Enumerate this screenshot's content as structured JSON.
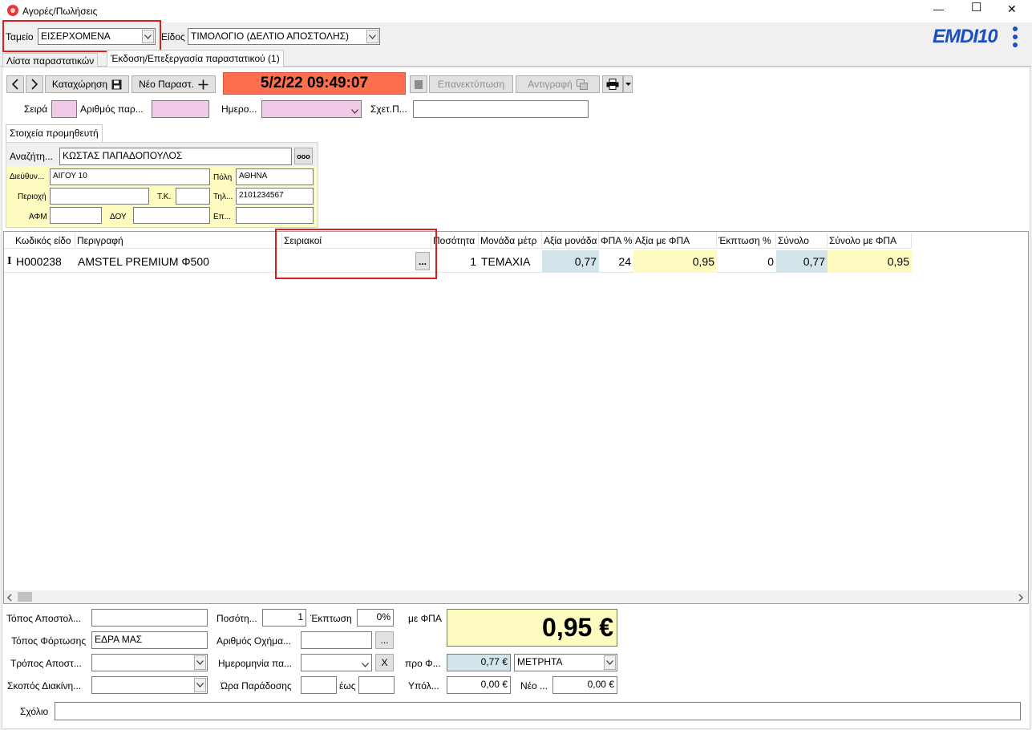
{
  "window": {
    "title": "Αγορές/Πωλήσεις",
    "minimize": "—",
    "maximize": "☐",
    "close": "✕",
    "logo": "EMDI10"
  },
  "top": {
    "tameio_label": "Ταμείο",
    "tameio_value": "ΕΙΣΕΡΧΟΜΕΝΑ",
    "eidos_label": "Είδος",
    "eidos_value": "ΤΙΜΟΛΟΓΙΟ (ΔΕΛΤΙΟ ΑΠΟΣΤΟΛΗΣ)"
  },
  "tabs": [
    "Λίστα παραστατικών",
    "Έκδοση/Επεξεργασία παραστατικού (1)"
  ],
  "toolbar": {
    "prev": "<",
    "next": ">",
    "save_label": "Καταχώρηση",
    "new_label": "Νέο Παραστ.",
    "datetime": "5/2/22 09:49:07",
    "reprint_label": "Επανεκτύπωση",
    "copy_label": "Αντιγραφή"
  },
  "doc": {
    "seira_label": "Σειρά",
    "seira_value": "",
    "arithmos_label": "Αριθμός παρ...",
    "arithmos_value": "",
    "date_label": "Ημερο...",
    "date_value": "",
    "sxet_label": "Σχετ.Π...",
    "sxet_value": ""
  },
  "supplier": {
    "tab": "Στοιχεία προμηθευτή",
    "search_label": "Αναζήτη...",
    "search_value": "ΚΩΣΤΑΣ ΠΑΠΑΔΟΠΟΥΛΟΣ",
    "more": "ooo",
    "address_label": "Διεύθυν...",
    "address_value": "ΑΙΓΟΥ 10",
    "city_label": "Πόλη",
    "city_value": "ΑΘΗΝΑ",
    "area_label": "Περιοχή",
    "area_value": "",
    "tk_label": "Τ.Κ.",
    "tk_value": "",
    "phone_label": "Τηλ...",
    "phone_value": "2101234567",
    "afm_label": "ΑΦΜ",
    "afm_value": "",
    "doy_label": "ΔΟΥ",
    "doy_value": "",
    "ep_label": "Επ...",
    "ep_value": ""
  },
  "grid": {
    "headers": [
      "Κωδικός είδο",
      "Περιγραφή",
      "Σειριακοί",
      "Ποσότητα",
      "Μονάδα μέτρ",
      "Αξία μονάδα",
      "ΦΠΑ %",
      "Αξία με ΦΠΑ",
      "Έκπτωση %",
      "Σύνολο",
      "Σύνολο με ΦΠΑ"
    ],
    "row": {
      "marker": "I",
      "code": "H000238",
      "desc": "AMSTEL PREMIUM Φ500",
      "serial": "",
      "serial_btn": "...",
      "qty": "1",
      "unit": "ΤΕΜΑΧΙΑ",
      "unit_price": "0,77",
      "vat": "24",
      "price_vat": "0,95",
      "discount": "0",
      "total": "0,77",
      "total_vat": "0,95"
    }
  },
  "footer": {
    "topos_apostolis_label": "Τόπος Αποστολ...",
    "topos_apostolis_value": "",
    "topos_fortosis_label": "Τόπος Φόρτωσης",
    "topos_fortosis_value": "ΕΔΡΑ ΜΑΣ",
    "tropos_label": "Τρόπος Αποστ...",
    "tropos_value": "",
    "skopos_label": "Σκοπός Διακίνη...",
    "skopos_value": "",
    "posotita_label": "Ποσότη...",
    "posotita_value": "1",
    "ekptosi_label": "Έκπτωση",
    "ekptosi_value": "0%",
    "arithmos_oximatos_label": "Αριθμός Οχήμα...",
    "arithmos_oximatos_value": "",
    "dots": "...",
    "imerominia_label": "Ημερομηνία πα...",
    "imerominia_value": "",
    "clear_btn": "X",
    "ora_label": "Ώρα Παράδοσης",
    "ora_value": "",
    "eos_label": "έως",
    "eos_value": "",
    "me_fpa_label": "με ΦΠΑ",
    "total": "0,95 €",
    "pro_fpa_label": "προ Φ...",
    "pro_fpa_value": "0,77 €",
    "payment": "ΜΕΤΡΗΤΑ",
    "ypol_label": "Υπόλ...",
    "ypol_value": "0,00 €",
    "neo_label": "Νέο ...",
    "neo_value": "0,00 €",
    "sxolio_label": "Σχόλιο",
    "sxolio_value": ""
  },
  "colors": {
    "datetime_bg": "#ff6f4f",
    "highlight": "#e11c1c",
    "pink": "#f3c9e8",
    "yellow": "#fdfbbf",
    "blue": "#d3e4ea",
    "logo_blue": "#1a4fc4"
  }
}
